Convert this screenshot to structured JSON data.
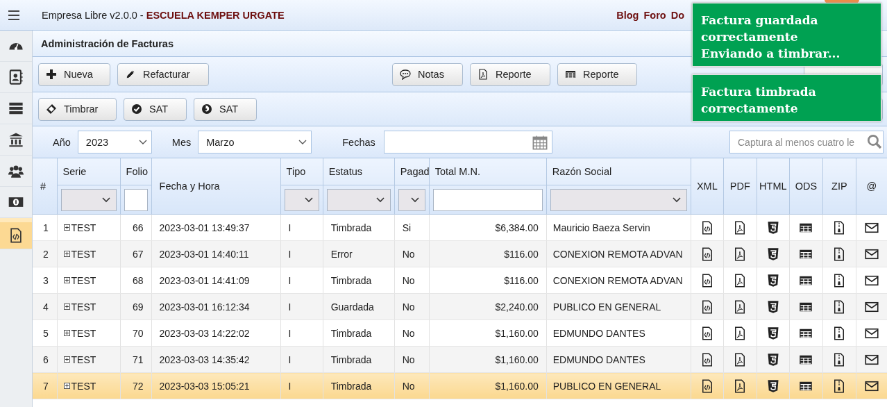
{
  "header": {
    "app_name": "Empresa Libre v2.0.0 - ",
    "company": "ESCUELA KEMPER URGATE",
    "links": [
      "Blog",
      "Foro",
      "Do"
    ]
  },
  "sidebar": {
    "items": [
      {
        "selected": false
      },
      {
        "selected": false
      },
      {
        "selected": false
      },
      {
        "selected": false
      },
      {
        "selected": false
      },
      {
        "selected": false
      },
      {
        "selected": true
      }
    ]
  },
  "panel_title": "Administración de Facturas",
  "toolbar_1": [
    "Nueva",
    "Refacturar",
    "Notas",
    "Reporte",
    "Reporte"
  ],
  "toolbar_2": [
    "Timbrar",
    "SAT",
    "SAT"
  ],
  "filters": {
    "year_label": "Año",
    "year": "2023",
    "month_label": "Mes",
    "month": "Marzo",
    "dates_label": "Fechas",
    "search_placeholder": "Captura al menos cuatro le"
  },
  "table": {
    "columns": [
      {
        "label": "#",
        "kind": "plain"
      },
      {
        "label": "Serie",
        "kind": "select"
      },
      {
        "label": "Folio",
        "kind": "input"
      },
      {
        "label": "Fecha y Hora",
        "kind": "plain"
      },
      {
        "label": "Tipo",
        "kind": "select"
      },
      {
        "label": "Estatus",
        "kind": "select"
      },
      {
        "label": "Pagad",
        "kind": "select"
      },
      {
        "label": "Total M.N.",
        "kind": "input"
      },
      {
        "label": "Razón Social",
        "kind": "select"
      }
    ],
    "file_columns": [
      {
        "label": "XML",
        "kind": "xml"
      },
      {
        "label": "PDF",
        "kind": "pdf"
      },
      {
        "label": "HTML",
        "kind": "html"
      },
      {
        "label": "ODS",
        "kind": "ods"
      },
      {
        "label": "ZIP",
        "kind": "zip"
      },
      {
        "label": "@",
        "kind": "mail"
      }
    ],
    "rows": [
      {
        "num": "1",
        "serie": "TEST",
        "folio": "66",
        "fecha": "2023-03-01 13:49:37",
        "tipo": "I",
        "estatus": "Timbrada",
        "pagada": "Si",
        "total": "$6,384.00",
        "razon": "Mauricio Baeza Servin",
        "selected": false
      },
      {
        "num": "2",
        "serie": "TEST",
        "folio": "67",
        "fecha": "2023-03-01 14:40:11",
        "tipo": "I",
        "estatus": "Error",
        "pagada": "No",
        "total": "$116.00",
        "razon": "CONEXION REMOTA ADVAN",
        "selected": false
      },
      {
        "num": "3",
        "serie": "TEST",
        "folio": "68",
        "fecha": "2023-03-01 14:41:09",
        "tipo": "I",
        "estatus": "Timbrada",
        "pagada": "No",
        "total": "$116.00",
        "razon": "CONEXION REMOTA ADVAN",
        "selected": false
      },
      {
        "num": "4",
        "serie": "TEST",
        "folio": "69",
        "fecha": "2023-03-01 16:12:34",
        "tipo": "I",
        "estatus": "Guardada",
        "pagada": "No",
        "total": "$2,240.00",
        "razon": "PUBLICO EN GENERAL",
        "selected": false
      },
      {
        "num": "5",
        "serie": "TEST",
        "folio": "70",
        "fecha": "2023-03-03 14:22:02",
        "tipo": "I",
        "estatus": "Timbrada",
        "pagada": "No",
        "total": "$1,160.00",
        "razon": "EDMUNDO DANTES",
        "selected": false
      },
      {
        "num": "6",
        "serie": "TEST",
        "folio": "71",
        "fecha": "2023-03-03 14:35:42",
        "tipo": "I",
        "estatus": "Timbrada",
        "pagada": "No",
        "total": "$1,160.00",
        "razon": "EDMUNDO DANTES",
        "selected": false
      },
      {
        "num": "7",
        "serie": "TEST",
        "folio": "72",
        "fecha": "2023-03-03 15:05:21",
        "tipo": "I",
        "estatus": "Timbrada",
        "pagada": "No",
        "total": "$1,160.00",
        "razon": "PUBLICO EN GENERAL",
        "selected": true
      }
    ]
  },
  "notifications": [
    {
      "lines": [
        "Factura guardada",
        "correctamente",
        "Enviando a timbrar..."
      ]
    },
    {
      "lines": [
        "Factura timbrada",
        "correctamente"
      ]
    }
  ]
}
